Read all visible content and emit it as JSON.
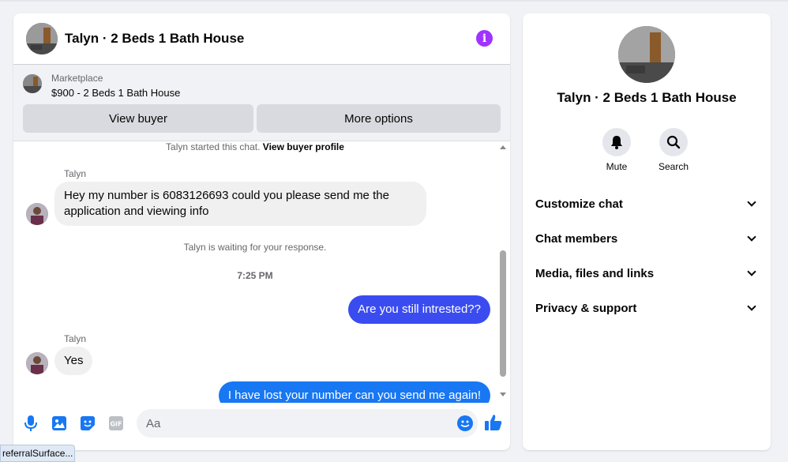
{
  "listing": {
    "title": "Talyn · 2 Beds 1 Bath House"
  },
  "marketplace": {
    "label": "Marketplace",
    "price_line": "$900 - 2 Beds 1 Bath House",
    "view_buyer": "View buyer",
    "more_options": "More options"
  },
  "messages": {
    "started": "Talyn started this chat.",
    "view_buyer_profile": "View buyer profile",
    "sender_name": "Talyn",
    "msg1": "Hey my number is 6083126693 could you please send me the application and viewing info",
    "waiting": "Talyn is waiting for your response.",
    "time": "7:25 PM",
    "out1": "Are you still intrested??",
    "msg2": "Yes",
    "out2": "I have lost your number can you send me again!"
  },
  "colors": {
    "accent": "#a033ff",
    "outgoing_1": "#3a4cf0",
    "outgoing_2": "#1877f2",
    "composer_icon": "#1877f2"
  },
  "composer": {
    "placeholder": "Aa"
  },
  "side": {
    "title": "Talyn · 2 Beds 1 Bath House",
    "mute": "Mute",
    "search": "Search",
    "rows": [
      "Customize chat",
      "Chat members",
      "Media, files and links",
      "Privacy & support"
    ]
  },
  "status_tip": "referralSurface..."
}
